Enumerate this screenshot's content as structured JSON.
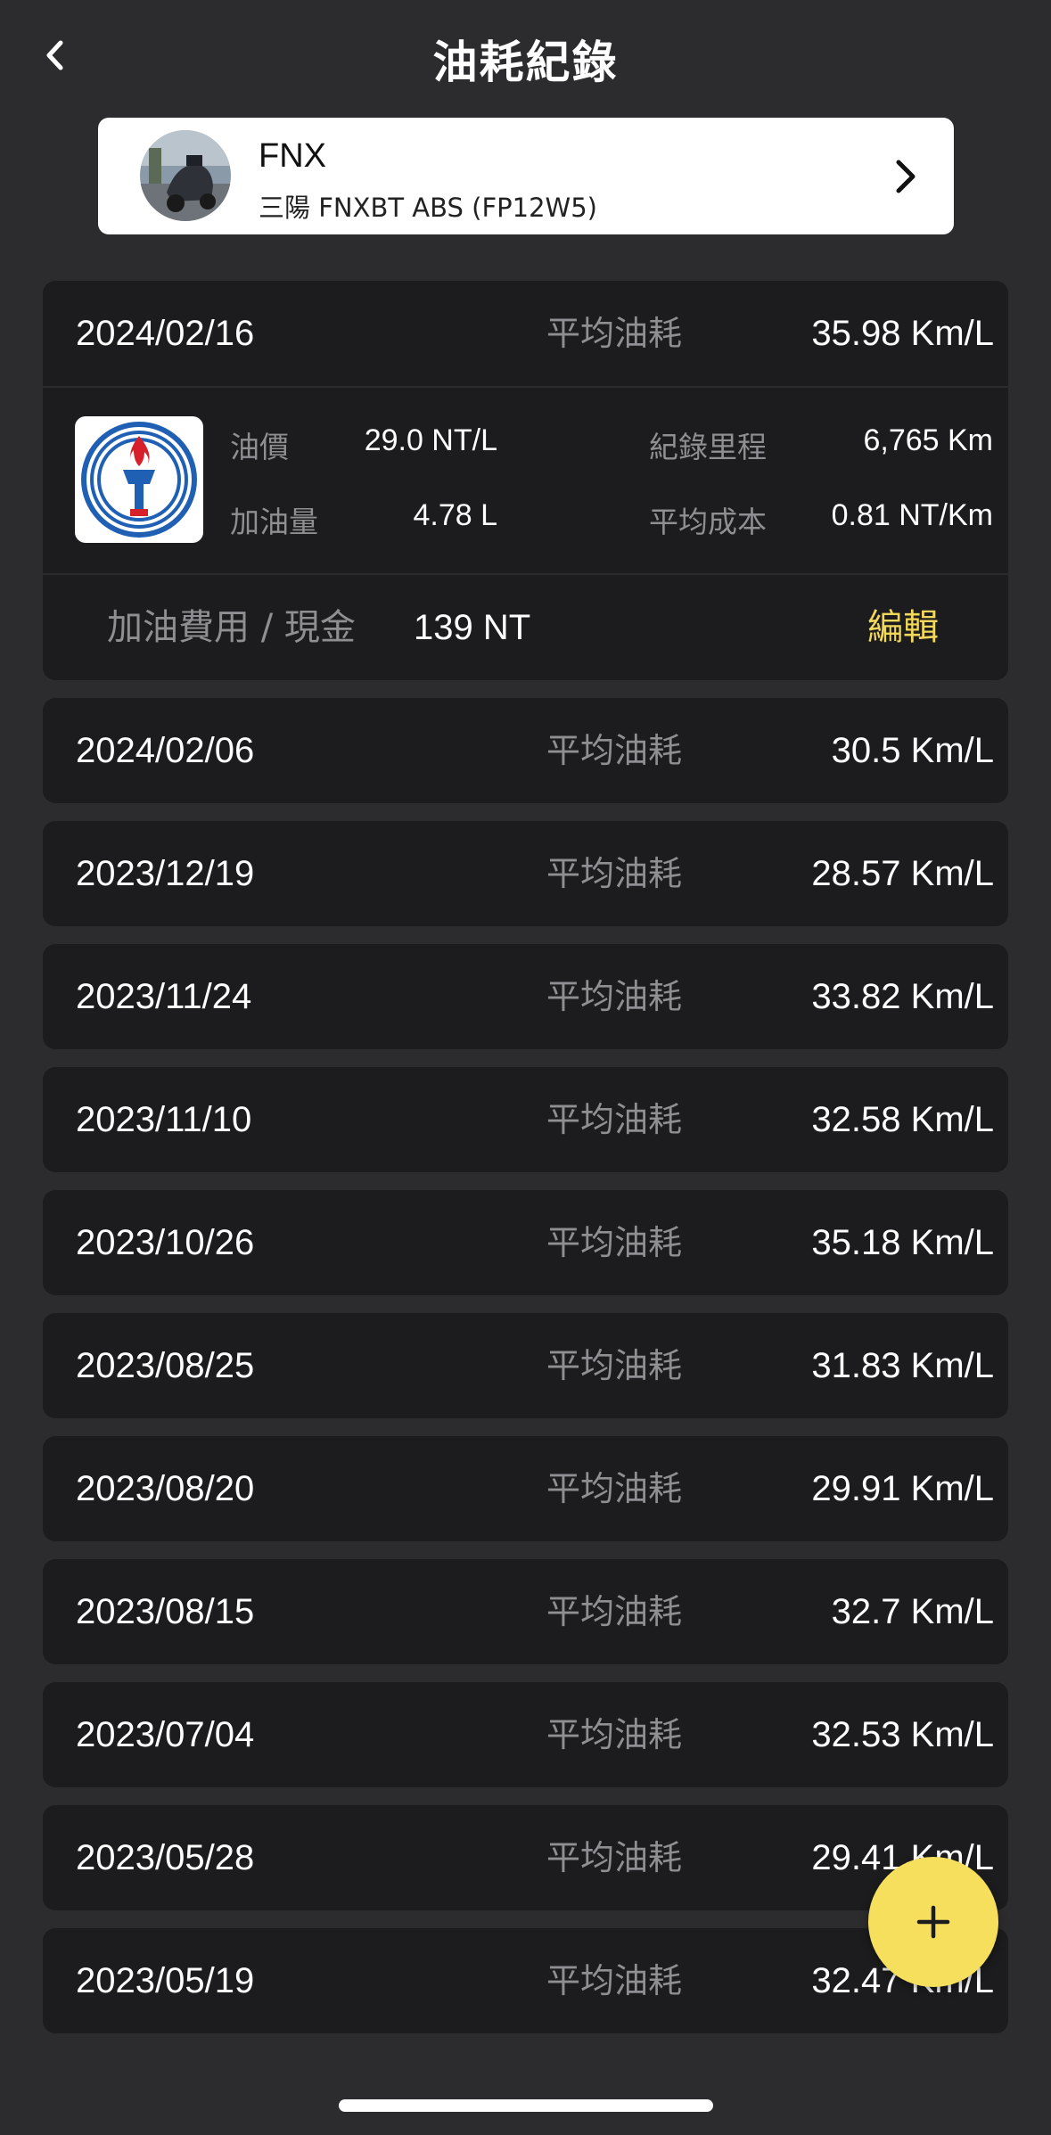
{
  "header": {
    "title": "油耗紀錄"
  },
  "vehicle": {
    "name": "FNX",
    "model": "三陽 FNXBT  ABS (FP12W5)"
  },
  "expanded": {
    "date": "2024/02/16",
    "avg_label": "平均油耗",
    "avg_value": "35.98 Km/L",
    "fuel_price_label": "油價",
    "fuel_price": "29.0 NT/L",
    "fuel_amount_label": "加油量",
    "fuel_amount": "4.78 L",
    "mileage_label": "紀錄里程",
    "mileage": "6,765 Km",
    "avg_cost_label": "平均成本",
    "avg_cost": "0.81 NT/Km",
    "cost_label": "加油費用 / 現金",
    "cost_value": "139 NT",
    "edit_label": "編輯"
  },
  "records": [
    {
      "date": "2024/02/06",
      "avg_label": "平均油耗",
      "avg_value": "30.5 Km/L"
    },
    {
      "date": "2023/12/19",
      "avg_label": "平均油耗",
      "avg_value": "28.57 Km/L"
    },
    {
      "date": "2023/11/24",
      "avg_label": "平均油耗",
      "avg_value": "33.82 Km/L"
    },
    {
      "date": "2023/11/10",
      "avg_label": "平均油耗",
      "avg_value": "32.58 Km/L"
    },
    {
      "date": "2023/10/26",
      "avg_label": "平均油耗",
      "avg_value": "35.18 Km/L"
    },
    {
      "date": "2023/08/25",
      "avg_label": "平均油耗",
      "avg_value": "31.83 Km/L"
    },
    {
      "date": "2023/08/20",
      "avg_label": "平均油耗",
      "avg_value": "29.91 Km/L"
    },
    {
      "date": "2023/08/15",
      "avg_label": "平均油耗",
      "avg_value": "32.7 Km/L"
    },
    {
      "date": "2023/07/04",
      "avg_label": "平均油耗",
      "avg_value": "32.53 Km/L"
    },
    {
      "date": "2023/05/28",
      "avg_label": "平均油耗",
      "avg_value": "29.41 Km/L"
    },
    {
      "date": "2023/05/19",
      "avg_label": "平均油耗",
      "avg_value": "32.47 Km/L"
    }
  ],
  "colors": {
    "background": "#2c2c2e",
    "card": "#1c1c1e",
    "accent": "#f6df5c",
    "muted": "#8e8e93"
  },
  "icons": {
    "back": "chevron-left-icon",
    "vehicle_more": "chevron-right-icon",
    "add": "plus-icon",
    "station": "cpc-logo-icon"
  }
}
